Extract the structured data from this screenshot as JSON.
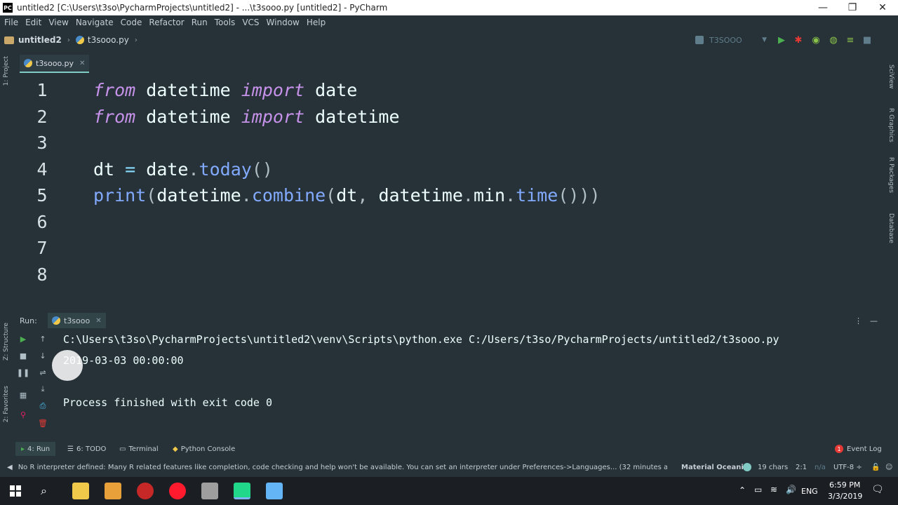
{
  "window": {
    "title": "untitled2 [C:\\Users\\t3so\\PycharmProjects\\untitled2] - ...\\t3sooo.py [untitled2] - PyCharm",
    "logo_text": "PC",
    "minimize": "—",
    "restore": "❐",
    "close": "✕"
  },
  "menu": [
    "File",
    "Edit",
    "View",
    "Navigate",
    "Code",
    "Refactor",
    "Run",
    "Tools",
    "VCS",
    "Window",
    "Help"
  ],
  "breadcrumb": {
    "project": "untitled2",
    "file": "t3sooo.py"
  },
  "toolbar": {
    "run_config": "T3SOOO"
  },
  "left_strip": {
    "project": "1: Project",
    "structure": "Z: Structure",
    "favorites": "2: Favorites"
  },
  "right_strip": {
    "sciview": "SciView",
    "rgraphics": "R Graphics",
    "rpackages": "R Packages",
    "database": "Database"
  },
  "editor_tab": {
    "label": "t3sooo.py",
    "close": "✕"
  },
  "editor": {
    "line_numbers": [
      "1",
      "2",
      "3",
      "4",
      "5",
      "6",
      "7",
      "8"
    ]
  },
  "run_panel": {
    "header": "Run:",
    "tab_label": "t3sooo",
    "tab_close": "✕",
    "output": [
      "C:\\Users\\t3so\\PycharmProjects\\untitled2\\venv\\Scripts\\python.exe C:/Users/t3so/PycharmProjects/untitled2/t3sooo.py",
      "2019-03-03 00:00:00",
      "",
      "Process finished with exit code 0"
    ]
  },
  "tool_windows": {
    "run": "4: Run",
    "todo": "6: TODO",
    "terminal": "Terminal",
    "python_console": "Python Console",
    "event_log": "Event Log",
    "event_log_count": "1"
  },
  "status": {
    "message": "No R interpreter defined: Many R related features like completion, code checking and help won't be available. You can set an interpreter under Preferences->Languages... (32 minutes ago)",
    "theme": "Material Oceanic",
    "chars": "19 chars",
    "position": "2:1",
    "na": "n/a",
    "encoding": "UTF-8 ÷"
  },
  "taskbar": {
    "language": "ENG",
    "time": "6:59 PM",
    "date": "3/3/2019"
  },
  "colors": {
    "bg": "#263238",
    "keyword": "#c792ea",
    "function": "#82aaff",
    "accent": "#80cbc4"
  }
}
